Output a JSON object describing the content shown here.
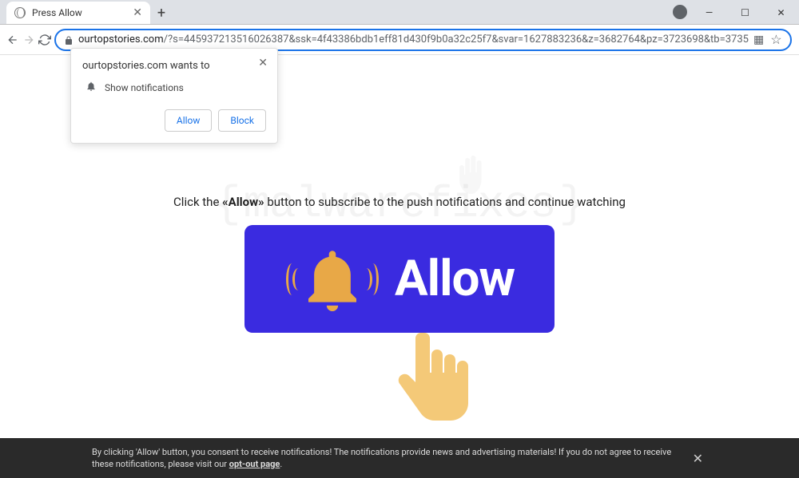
{
  "window": {
    "tab_title": "Press Allow",
    "newtab_tooltip": "+",
    "controls": {
      "minimize": "—",
      "maximize": "☐",
      "close": "✕"
    }
  },
  "toolbar": {
    "url_domain": "ourtopstories.com",
    "url_path": "/?s=445937213516026387&ssk=4f43386bdb1eff81d430f9b0a32c25f7&svar=1627883236&z=3682764&pz=3723698&tb=3735"
  },
  "permission": {
    "title": "ourtopstories.com wants to",
    "action": "Show notifications",
    "allow": "Allow",
    "block": "Block"
  },
  "page": {
    "instruction_pre": "Click the ",
    "instruction_bold": "«Allow»",
    "instruction_post": " button to subscribe to the push notifications and continue watching",
    "big_button": "Allow",
    "watermark": "malwarefixes"
  },
  "footer": {
    "text": "By clicking 'Allow' button, you consent to receive notifications! The notifications provide news and advertising materials! If you do not agree to receive these notifications, please visit our ",
    "link": "opt-out page",
    "close": "✕"
  }
}
